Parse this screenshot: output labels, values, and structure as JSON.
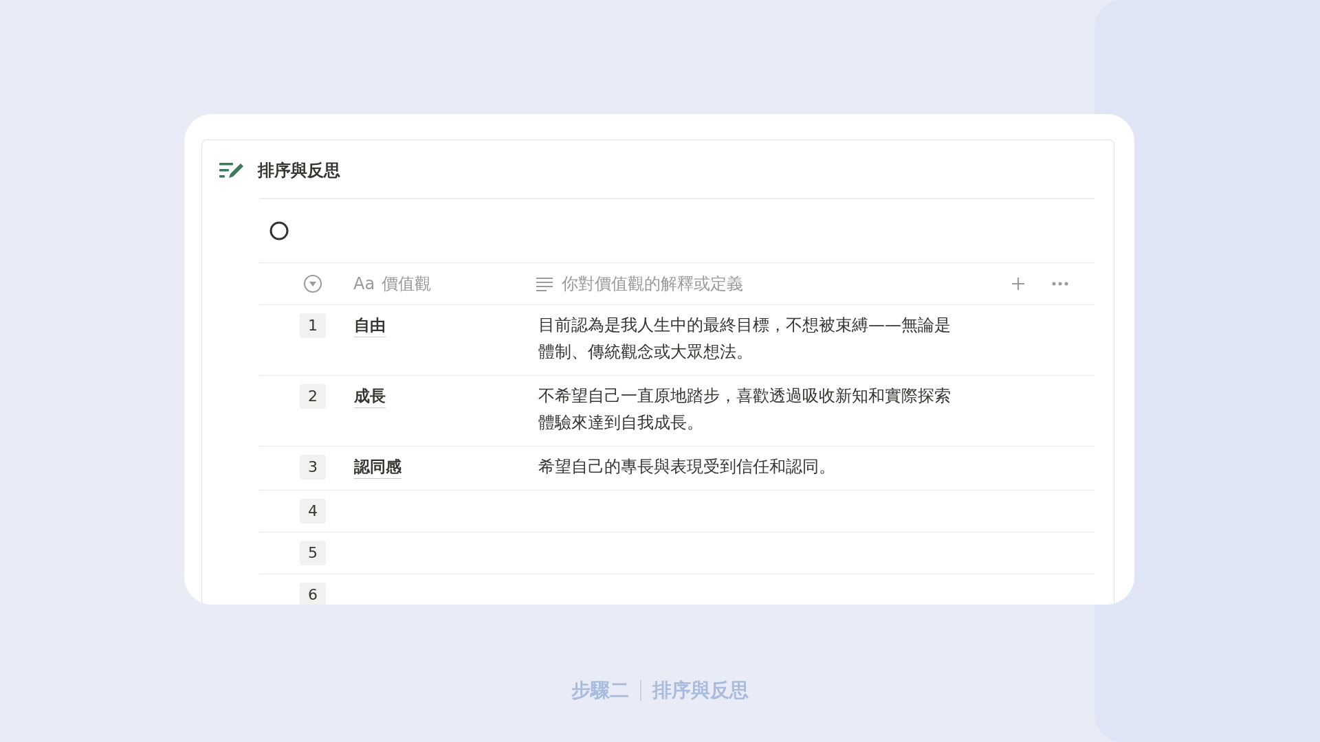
{
  "block": {
    "title": "排序與反思"
  },
  "table": {
    "columns": [
      {
        "kind": "number"
      },
      {
        "kind": "title",
        "type_marker": "Aa",
        "label": "價值觀"
      },
      {
        "kind": "text",
        "label": "你對價值觀的解釋或定義"
      }
    ],
    "rows": [
      {
        "number": "1",
        "value": "自由",
        "description": "目前認為是我人生中的最終目標，不想被束縛——無論是體制、傳統觀念或大眾想法。"
      },
      {
        "number": "2",
        "value": "成長",
        "description": "不希望自己一直原地踏步，喜歡透過吸收新知和實際探索體驗來達到自我成長。"
      },
      {
        "number": "3",
        "value": "認同感",
        "description": "希望自己的專長與表現受到信任和認同。"
      },
      {
        "number": "4"
      },
      {
        "number": "5"
      },
      {
        "number": "6"
      }
    ]
  },
  "caption": {
    "step": "步驟二",
    "title": "排序與反思"
  }
}
